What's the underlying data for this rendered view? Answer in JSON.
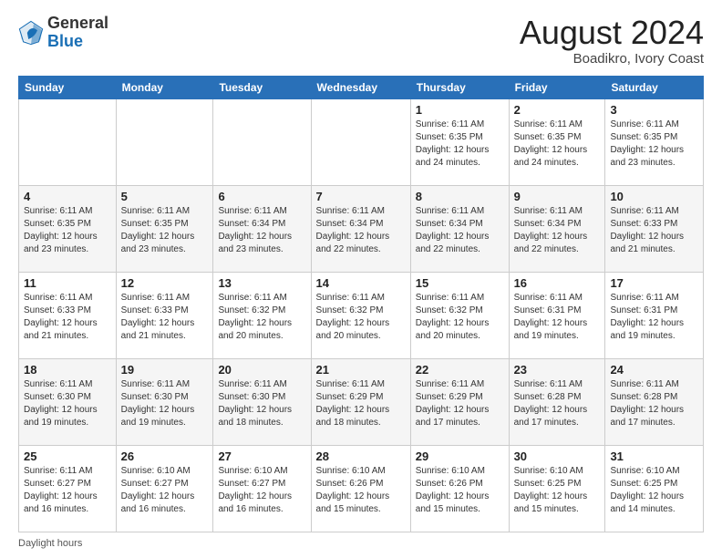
{
  "header": {
    "logo_general": "General",
    "logo_blue": "Blue",
    "month_year": "August 2024",
    "location": "Boadikro, Ivory Coast"
  },
  "footer": {
    "label": "Daylight hours"
  },
  "days_of_week": [
    "Sunday",
    "Monday",
    "Tuesday",
    "Wednesday",
    "Thursday",
    "Friday",
    "Saturday"
  ],
  "weeks": [
    [
      {
        "num": "",
        "info": ""
      },
      {
        "num": "",
        "info": ""
      },
      {
        "num": "",
        "info": ""
      },
      {
        "num": "",
        "info": ""
      },
      {
        "num": "1",
        "info": "Sunrise: 6:11 AM\nSunset: 6:35 PM\nDaylight: 12 hours and 24 minutes."
      },
      {
        "num": "2",
        "info": "Sunrise: 6:11 AM\nSunset: 6:35 PM\nDaylight: 12 hours and 24 minutes."
      },
      {
        "num": "3",
        "info": "Sunrise: 6:11 AM\nSunset: 6:35 PM\nDaylight: 12 hours and 23 minutes."
      }
    ],
    [
      {
        "num": "4",
        "info": "Sunrise: 6:11 AM\nSunset: 6:35 PM\nDaylight: 12 hours and 23 minutes."
      },
      {
        "num": "5",
        "info": "Sunrise: 6:11 AM\nSunset: 6:35 PM\nDaylight: 12 hours and 23 minutes."
      },
      {
        "num": "6",
        "info": "Sunrise: 6:11 AM\nSunset: 6:34 PM\nDaylight: 12 hours and 23 minutes."
      },
      {
        "num": "7",
        "info": "Sunrise: 6:11 AM\nSunset: 6:34 PM\nDaylight: 12 hours and 22 minutes."
      },
      {
        "num": "8",
        "info": "Sunrise: 6:11 AM\nSunset: 6:34 PM\nDaylight: 12 hours and 22 minutes."
      },
      {
        "num": "9",
        "info": "Sunrise: 6:11 AM\nSunset: 6:34 PM\nDaylight: 12 hours and 22 minutes."
      },
      {
        "num": "10",
        "info": "Sunrise: 6:11 AM\nSunset: 6:33 PM\nDaylight: 12 hours and 21 minutes."
      }
    ],
    [
      {
        "num": "11",
        "info": "Sunrise: 6:11 AM\nSunset: 6:33 PM\nDaylight: 12 hours and 21 minutes."
      },
      {
        "num": "12",
        "info": "Sunrise: 6:11 AM\nSunset: 6:33 PM\nDaylight: 12 hours and 21 minutes."
      },
      {
        "num": "13",
        "info": "Sunrise: 6:11 AM\nSunset: 6:32 PM\nDaylight: 12 hours and 20 minutes."
      },
      {
        "num": "14",
        "info": "Sunrise: 6:11 AM\nSunset: 6:32 PM\nDaylight: 12 hours and 20 minutes."
      },
      {
        "num": "15",
        "info": "Sunrise: 6:11 AM\nSunset: 6:32 PM\nDaylight: 12 hours and 20 minutes."
      },
      {
        "num": "16",
        "info": "Sunrise: 6:11 AM\nSunset: 6:31 PM\nDaylight: 12 hours and 19 minutes."
      },
      {
        "num": "17",
        "info": "Sunrise: 6:11 AM\nSunset: 6:31 PM\nDaylight: 12 hours and 19 minutes."
      }
    ],
    [
      {
        "num": "18",
        "info": "Sunrise: 6:11 AM\nSunset: 6:30 PM\nDaylight: 12 hours and 19 minutes."
      },
      {
        "num": "19",
        "info": "Sunrise: 6:11 AM\nSunset: 6:30 PM\nDaylight: 12 hours and 19 minutes."
      },
      {
        "num": "20",
        "info": "Sunrise: 6:11 AM\nSunset: 6:30 PM\nDaylight: 12 hours and 18 minutes."
      },
      {
        "num": "21",
        "info": "Sunrise: 6:11 AM\nSunset: 6:29 PM\nDaylight: 12 hours and 18 minutes."
      },
      {
        "num": "22",
        "info": "Sunrise: 6:11 AM\nSunset: 6:29 PM\nDaylight: 12 hours and 17 minutes."
      },
      {
        "num": "23",
        "info": "Sunrise: 6:11 AM\nSunset: 6:28 PM\nDaylight: 12 hours and 17 minutes."
      },
      {
        "num": "24",
        "info": "Sunrise: 6:11 AM\nSunset: 6:28 PM\nDaylight: 12 hours and 17 minutes."
      }
    ],
    [
      {
        "num": "25",
        "info": "Sunrise: 6:11 AM\nSunset: 6:27 PM\nDaylight: 12 hours and 16 minutes."
      },
      {
        "num": "26",
        "info": "Sunrise: 6:10 AM\nSunset: 6:27 PM\nDaylight: 12 hours and 16 minutes."
      },
      {
        "num": "27",
        "info": "Sunrise: 6:10 AM\nSunset: 6:27 PM\nDaylight: 12 hours and 16 minutes."
      },
      {
        "num": "28",
        "info": "Sunrise: 6:10 AM\nSunset: 6:26 PM\nDaylight: 12 hours and 15 minutes."
      },
      {
        "num": "29",
        "info": "Sunrise: 6:10 AM\nSunset: 6:26 PM\nDaylight: 12 hours and 15 minutes."
      },
      {
        "num": "30",
        "info": "Sunrise: 6:10 AM\nSunset: 6:25 PM\nDaylight: 12 hours and 15 minutes."
      },
      {
        "num": "31",
        "info": "Sunrise: 6:10 AM\nSunset: 6:25 PM\nDaylight: 12 hours and 14 minutes."
      }
    ]
  ]
}
